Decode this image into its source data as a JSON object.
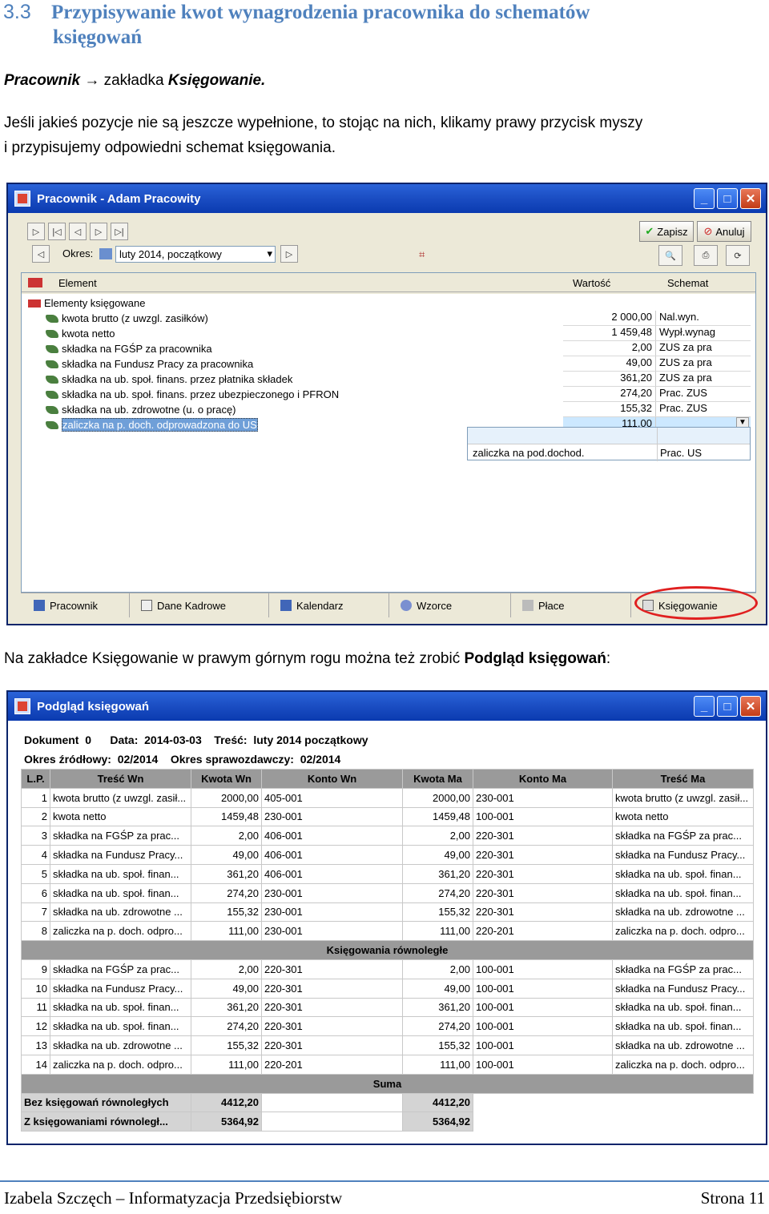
{
  "heading": {
    "number": "3.3",
    "line1": "Przypisywanie kwot wynagrodzenia pracownika do schematów",
    "line2": "księgowań"
  },
  "path": {
    "part1": "Pracownik",
    "arrow": "→",
    "part2": "zakładka",
    "part3": "Księgowanie."
  },
  "intro": {
    "line1": "Jeśli jakieś pozycje nie są jeszcze wypełnione, to stojąc na nich, klikamy prawy przycisk myszy",
    "line2": "i przypisujemy odpowiedni schemat księgowania."
  },
  "win1": {
    "title": "Pracownik - Adam Pracowity",
    "zapisz": "Zapisz",
    "anuluj": "Anuluj",
    "okres_label": "Okres:",
    "okres_value": "luty 2014, początkowy",
    "col_element": "Element",
    "col_wartosc": "Wartość",
    "col_schemat": "Schemat",
    "root": "Elementy księgowane",
    "items": [
      {
        "name": "kwota brutto (z uwzgl. zasiłków)",
        "value": "2 000,00",
        "schema": "Nal.wyn."
      },
      {
        "name": "kwota netto",
        "value": "1 459,48",
        "schema": "Wypł.wynag"
      },
      {
        "name": "składka na FGŚP za pracownika",
        "value": "2,00",
        "schema": "ZUS za pra"
      },
      {
        "name": "składka na Fundusz Pracy za pracownika",
        "value": "49,00",
        "schema": "ZUS za pra"
      },
      {
        "name": "składka na ub. społ. finans. przez płatnika składek",
        "value": "361,20",
        "schema": "ZUS za pra"
      },
      {
        "name": "składka na ub. społ. finans. przez ubezpieczonego i PFRON",
        "value": "274,20",
        "schema": "Prac. ZUS"
      },
      {
        "name": "składka na ub. zdrowotne (u. o pracę)",
        "value": "155,32",
        "schema": "Prac. ZUS"
      },
      {
        "name": "zaliczka na p. doch. odprowadzona do US",
        "value": "111,00",
        "schema": ""
      }
    ],
    "dropdown": {
      "name": "zaliczka na pod.dochod.",
      "schema": "Prac. US"
    },
    "tabs": [
      "Pracownik",
      "Dane Kadrowe",
      "Kalendarz",
      "Wzorce",
      "Płace",
      "Księgowanie"
    ]
  },
  "mid_text": {
    "text": "Na zakładce Księgowanie w prawym górnym rogu można też zrobić ",
    "bold": "Podgląd księgowań",
    ":": ":"
  },
  "win2": {
    "title": "Podgląd księgowań",
    "info1": "Dokument  0      Data:  2014-03-03    Treść:  luty 2014 początkowy",
    "info2": "Okres źródłowy:  02/2014    Okres sprawozdawczy:  02/2014",
    "headers": [
      "L.P.",
      "Treść Wn",
      "Kwota Wn",
      "Konto Wn",
      "Kwota Ma",
      "Konto Ma",
      "Treść Ma"
    ],
    "rows": [
      [
        "1",
        "kwota brutto (z uwzgl. zasił...",
        "2000,00",
        "405-001",
        "2000,00",
        "230-001",
        "kwota brutto (z uwzgl. zasił..."
      ],
      [
        "2",
        "kwota netto",
        "1459,48",
        "230-001",
        "1459,48",
        "100-001",
        "kwota netto"
      ],
      [
        "3",
        "składka na FGŚP za prac...",
        "2,00",
        "406-001",
        "2,00",
        "220-301",
        "składka na FGŚP za prac..."
      ],
      [
        "4",
        "składka na Fundusz Pracy...",
        "49,00",
        "406-001",
        "49,00",
        "220-301",
        "składka na Fundusz Pracy..."
      ],
      [
        "5",
        "składka na ub. społ. finan...",
        "361,20",
        "406-001",
        "361,20",
        "220-301",
        "składka na ub. społ. finan..."
      ],
      [
        "6",
        "składka na ub. społ. finan...",
        "274,20",
        "230-001",
        "274,20",
        "220-301",
        "składka na ub. społ. finan..."
      ],
      [
        "7",
        "składka na ub. zdrowotne ...",
        "155,32",
        "230-001",
        "155,32",
        "220-301",
        "składka na ub. zdrowotne ..."
      ],
      [
        "8",
        "zaliczka na p. doch. odpro...",
        "111,00",
        "230-001",
        "111,00",
        "220-201",
        "zaliczka na p. doch. odpro..."
      ]
    ],
    "group": "Księgowania równoległe",
    "rows2": [
      [
        "9",
        "składka na FGŚP za prac...",
        "2,00",
        "220-301",
        "2,00",
        "100-001",
        "składka na FGŚP za prac..."
      ],
      [
        "10",
        "składka na Fundusz Pracy...",
        "49,00",
        "220-301",
        "49,00",
        "100-001",
        "składka na Fundusz Pracy..."
      ],
      [
        "11",
        "składka na ub. społ. finan...",
        "361,20",
        "220-301",
        "361,20",
        "100-001",
        "składka na ub. społ. finan..."
      ],
      [
        "12",
        "składka na ub. społ. finan...",
        "274,20",
        "220-301",
        "274,20",
        "100-001",
        "składka na ub. społ. finan..."
      ],
      [
        "13",
        "składka na ub. zdrowotne ...",
        "155,32",
        "220-301",
        "155,32",
        "100-001",
        "składka na ub. zdrowotne ..."
      ],
      [
        "14",
        "zaliczka na p. doch. odpro...",
        "111,00",
        "220-201",
        "111,00",
        "100-001",
        "zaliczka na p. doch. odpro..."
      ]
    ],
    "suma": "Suma",
    "sum1": {
      "label": "Bez księgowań równoległych",
      "wn": "4412,20",
      "ma": "4412,20"
    },
    "sum2": {
      "label": "Z księgowaniami równoległ...",
      "wn": "5364,92",
      "ma": "5364,92"
    }
  },
  "footer": {
    "left": "Izabela Szczęch – Informatyzacja Przedsiębiorstw",
    "right": "Strona 11"
  },
  "colors": {
    "heading": "#4f81bd",
    "titlebar": "#1c4fc4",
    "highlight": "#cce8ff",
    "circle": "#e02020"
  }
}
